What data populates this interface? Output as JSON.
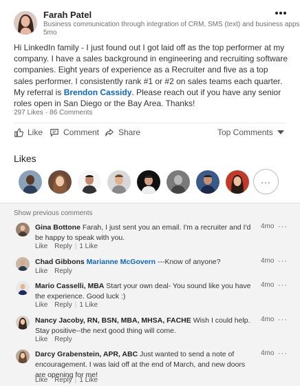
{
  "post": {
    "author_name": "Farah Patel",
    "author_headline": "Business communication through integration of CRM, SMS (text) and business apps",
    "time": "5mo",
    "body_part1": "Hi LinkedIn family - I just found out I got laid off as the top performer at my company. I have a sales background in engineering and recruiting software companies. Eight years of experience as a Recruiter and five as a top sales performer. I consistently rank #1 or #2 on sales teams each quarter. My referral is ",
    "mention": "Brendon Cassidy",
    "body_part2": ". Please reach out if you have any senior roles open in San Diego or the Bay Area. Thanks!",
    "likes_count": "297 Likes",
    "comments_count": "86 Comments",
    "more_icon": "more-horizontal-icon"
  },
  "actions": {
    "like": "Like",
    "comment": "Comment",
    "share": "Share",
    "sort": "Top Comments"
  },
  "likes": {
    "title": "Likes",
    "more": "..."
  },
  "comments": {
    "show_previous": "Show previous comments",
    "items": [
      {
        "name": "Gina Bottone",
        "mention": "",
        "text": "Farah, I just sent you an email. I'm a recruiter and I'd be happy to speak with you.",
        "time": "4mo",
        "like": "Like",
        "reply": "Reply",
        "likes": "1 Like"
      },
      {
        "name": "Chad Gibbons",
        "mention": "Marianne McGovern",
        "text": "---Know of anyone?",
        "time": "4mo",
        "like": "Like",
        "reply": "Reply",
        "likes": ""
      },
      {
        "name": "Mario Casselli, MBA",
        "mention": "",
        "text": "Start your own deal- You sound like you have the experience. Good luck :)",
        "time": "4mo",
        "like": "Like",
        "reply": "Reply",
        "likes": "1 Like"
      },
      {
        "name": "Nancy Jacoby, RN, BSN, MBA, MHSA, FACHE",
        "mention": "",
        "text": "Wish I could help. Stay positive--the next good thing will come.",
        "time": "4mo",
        "like": "Like",
        "reply": "Reply",
        "likes": ""
      },
      {
        "name": "Darcy Grabenstein, APR, ABC",
        "mention": "",
        "text": "Just wanted to send a note of encouragement. I was laid off at the end of March, and new doors are opening for me!",
        "time": "4mo",
        "like": "Like",
        "reply": "Reply",
        "likes": "1 Like"
      }
    ]
  }
}
